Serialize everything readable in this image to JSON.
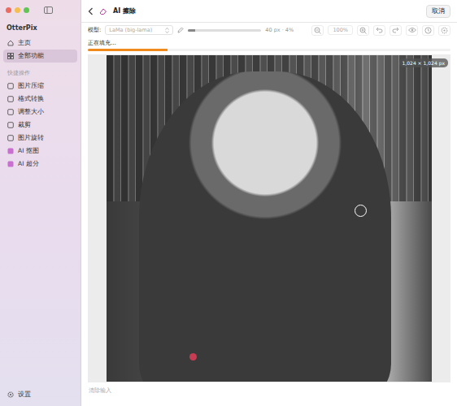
{
  "window": {
    "title": "OtterPix"
  },
  "sidebar": {
    "items": [
      {
        "label": "主页",
        "selected": false
      },
      {
        "label": "全部功能",
        "selected": true
      }
    ],
    "section": "快捷操作",
    "quick_actions": [
      {
        "label": "图片压缩",
        "selected": false
      },
      {
        "label": "格式转换",
        "selected": false
      },
      {
        "label": "调整大小",
        "selected": false
      },
      {
        "label": "裁剪",
        "selected": false
      },
      {
        "label": "图片旋转",
        "selected": false
      },
      {
        "label": "AI 抠图",
        "selected": false
      },
      {
        "label": "AI 超分",
        "selected": false
      }
    ],
    "footer": "设置"
  },
  "header": {
    "title": "AI 擦除",
    "cancel": "取消"
  },
  "toolbar": {
    "model_label": "模型:",
    "model": "LaMa (big-lama)",
    "brush_level": 0.1,
    "brush_reading": "40 px · 4%",
    "zoom": "100%",
    "disabled": true
  },
  "progress": {
    "label": "正在填充...",
    "level": 0.22
  },
  "canvas": {
    "size_badge": "1,024 × 1,024 px"
  },
  "footer": {
    "hint": "清除输入"
  }
}
